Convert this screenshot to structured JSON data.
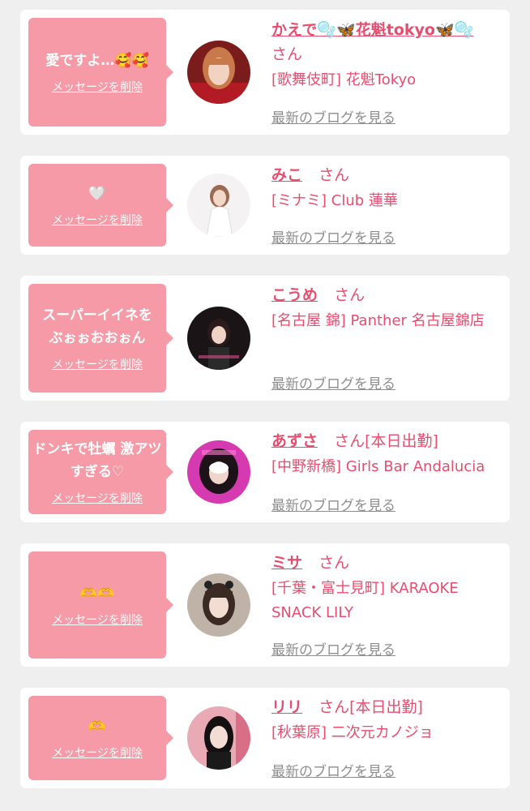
{
  "delete_label": "メッセージを削除",
  "blog_label": "最新のブログを見る",
  "san_suffix": "さん",
  "accent_color": "#e84d6f",
  "bubble_color": "#f59aa6",
  "cards": [
    {
      "message": "愛ですよ…🥰🥰",
      "name": "かえで🫧🦋花魁tokyo🦋🫧",
      "status": "",
      "shop": "[歌舞伎町] 花魁Tokyo"
    },
    {
      "message": "🤍",
      "name": "みこ",
      "status": "",
      "shop": "[ミナミ] Club 蓮華"
    },
    {
      "message": "スーパーイイネをぶぉぉおおぉん",
      "name": "こうめ",
      "status": "",
      "shop": "[名古屋 錦] Panther 名古屋錦店"
    },
    {
      "message": "ドンキで牡蠣 激アツすぎる♡",
      "name": "あずさ",
      "status": "[本日出勤]",
      "shop": "[中野新橋] Girls Bar Andalucia"
    },
    {
      "message": "🫶🫶",
      "name": "ミサ",
      "status": "",
      "shop": "[千葉・富士見町] KARAOKE SNACK LILY"
    },
    {
      "message": "🫶",
      "name": "リリ",
      "status": "[本日出勤]",
      "shop": "[秋葉原] 二次元カノジョ"
    }
  ]
}
